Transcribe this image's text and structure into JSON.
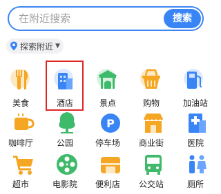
{
  "search": {
    "placeholder": "在附近搜索",
    "button_label": "搜索"
  },
  "explore": {
    "label": "探索附近"
  },
  "categories": [
    {
      "label": "美食",
      "icon": "fork-knife-icon",
      "selected": false
    },
    {
      "label": "酒店",
      "icon": "hotel-building-icon",
      "selected": true
    },
    {
      "label": "景点",
      "icon": "pavilion-icon",
      "selected": false
    },
    {
      "label": "购物",
      "icon": "shopping-basket-icon",
      "selected": false
    },
    {
      "label": "加油站",
      "icon": "gas-pump-icon",
      "selected": false
    },
    {
      "label": "咖啡厅",
      "icon": "coffee-cup-icon",
      "selected": false
    },
    {
      "label": "公园",
      "icon": "tree-icon",
      "selected": false
    },
    {
      "label": "停车场",
      "icon": "parking-icon",
      "selected": false
    },
    {
      "label": "商业街",
      "icon": "storefront-icon",
      "selected": false
    },
    {
      "label": "医院",
      "icon": "hospital-icon",
      "selected": false
    },
    {
      "label": "超市",
      "icon": "shopping-cart-icon",
      "selected": false
    },
    {
      "label": "电影院",
      "icon": "film-reel-icon",
      "selected": false
    },
    {
      "label": "便利店",
      "icon": "convenience-store-icon",
      "selected": false
    },
    {
      "label": "公交站",
      "icon": "bus-icon",
      "selected": false
    },
    {
      "label": "厕所",
      "icon": "restroom-icon",
      "selected": false
    }
  ],
  "colors": {
    "accent": "#3a85f5",
    "orange": "#f5a623",
    "green": "#3fb96a",
    "blue": "#3a85f5",
    "selection": "#e02525"
  }
}
